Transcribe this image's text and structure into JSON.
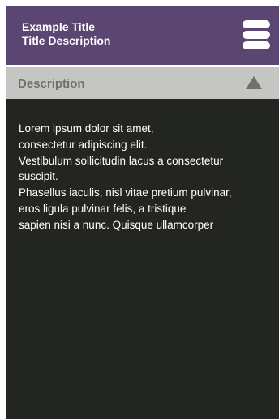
{
  "header": {
    "title": "Example Title",
    "subtitle": "Title Description",
    "menu_icon": "hamburger-menu-icon"
  },
  "section": {
    "label": "Description",
    "toggle_icon": "triangle-up-icon",
    "expanded": true
  },
  "content": {
    "lines": [
      "Lorem ipsum dolor sit amet,",
      "consectetur adipiscing elit.",
      "Vestibulum sollicitudin lacus a consectetur",
      "suscipit.",
      "Phasellus iaculis, nisl vitae pretium pulvinar,",
      "eros ligula pulvinar felis, a tristique",
      "sapien nisi a nunc. Quisque ullamcorper"
    ]
  },
  "colors": {
    "header_bg": "#5b4571",
    "section_bar_bg": "#c5c6c4",
    "section_text": "#6f716d",
    "body_bg": "#232521",
    "text": "#ffffff"
  }
}
